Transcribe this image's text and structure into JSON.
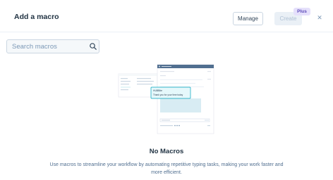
{
  "header": {
    "title": "Add a macro",
    "manage_label": "Manage",
    "create_label": "Create",
    "plus_badge": "Plus",
    "close_glyph": "✕"
  },
  "search": {
    "placeholder": "Search macros",
    "value": "",
    "icon": "search-icon"
  },
  "illustration": {
    "popup_title": "HUBBite",
    "popup_text": "Thank you for your time today"
  },
  "empty_state": {
    "title": "No Macros",
    "description": "Use macros to streamline your workflow by automating repetitive typing tasks, making your work faster and more efficient."
  },
  "colors": {
    "accent": "#00a4bd",
    "badge_bg": "#e5e0fb",
    "badge_text": "#5c4ab8",
    "border": "#cbd6e2"
  }
}
